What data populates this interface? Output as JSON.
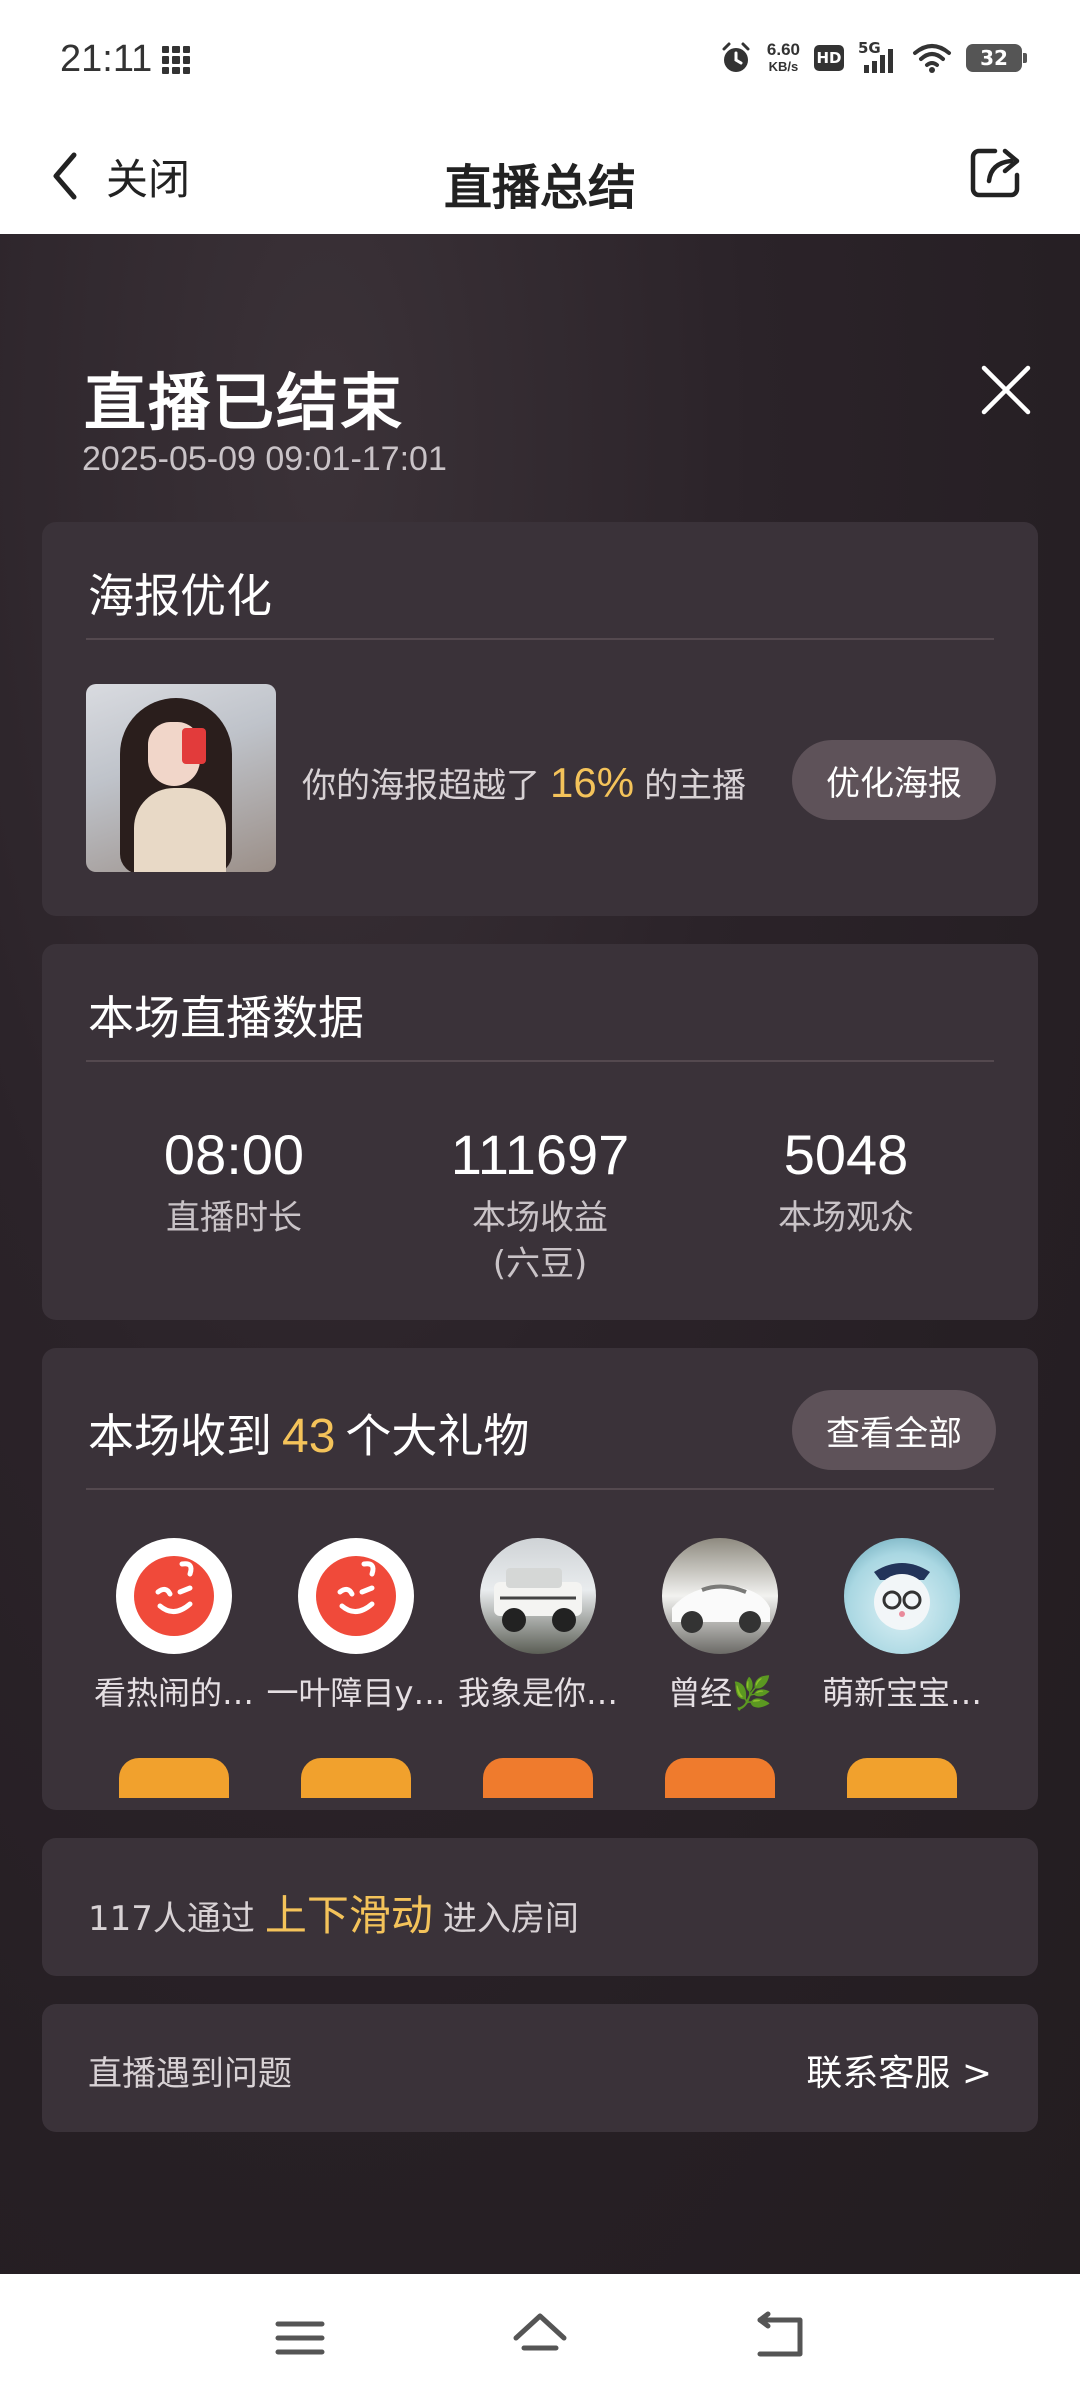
{
  "status_bar": {
    "time": "21:11",
    "speed_value": "6.60",
    "speed_unit": "KB/s",
    "hd_label": "HD",
    "network": "5G",
    "battery": "32"
  },
  "nav": {
    "back_label": "关闭",
    "title": "直播总结"
  },
  "summary": {
    "title": "直播已结束",
    "time_range": "2025-05-09 09:01-17:01"
  },
  "poster": {
    "title": "海报优化",
    "text_before": "你的海报超越了",
    "percent": "16%",
    "text_after": "的主播",
    "button": "优化海报"
  },
  "stats": {
    "title": "本场直播数据",
    "items": [
      {
        "value": "08:00",
        "label": "直播时长"
      },
      {
        "value": "111697",
        "label": "本场收益\n(六豆)"
      },
      {
        "value": "5048",
        "label": "本场观众"
      }
    ]
  },
  "gifts": {
    "title_before": "本场收到",
    "count": "43",
    "title_after": "个大礼物",
    "button": "查看全部",
    "users": [
      {
        "name": "看热闹的…",
        "avatar": "app-logo"
      },
      {
        "name": "一叶障目y…",
        "avatar": "app-logo"
      },
      {
        "name": "我象是你…",
        "avatar": "car-offroad"
      },
      {
        "name": "曾经🌿",
        "avatar": "car-white"
      },
      {
        "name": "萌新宝宝…",
        "avatar": "mouse-cartoon"
      }
    ]
  },
  "swipe": {
    "text_before": "117人通过",
    "highlight": "上下滑动",
    "text_after": "进入房间"
  },
  "problem": {
    "text": "直播遇到问题",
    "link": "联系客服 >"
  },
  "colors": {
    "accent": "#f4c35a",
    "card": "#3a3239",
    "background": "#2a2326",
    "pill": "#5e5259"
  }
}
